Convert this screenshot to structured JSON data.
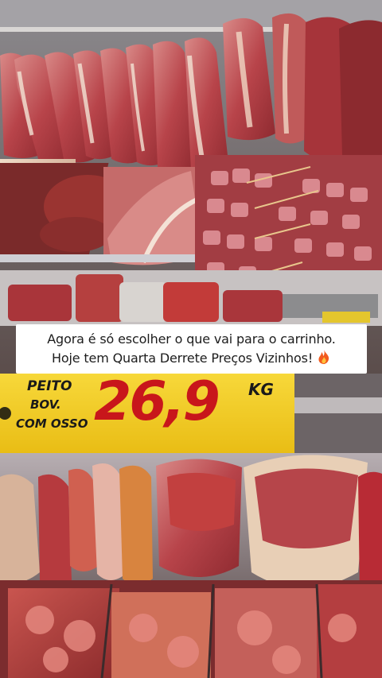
{
  "caption": {
    "line1": "Agora é só escolher o que vai para o carrinho.",
    "line2": "Hoje tem Quarta Derrete Preços Vizinhos!",
    "icon": "fire-emoji"
  },
  "price_sign": {
    "product_line1": "PEITO",
    "product_line2": "BOV.",
    "product_line3": "COM OSSO",
    "price": "26,9",
    "unit": "KG"
  },
  "colors": {
    "sign_yellow": "#f2cc1e",
    "price_red": "#c8161b",
    "meat_red": "#b83a3c",
    "fat_cream": "#e9d3bf"
  }
}
